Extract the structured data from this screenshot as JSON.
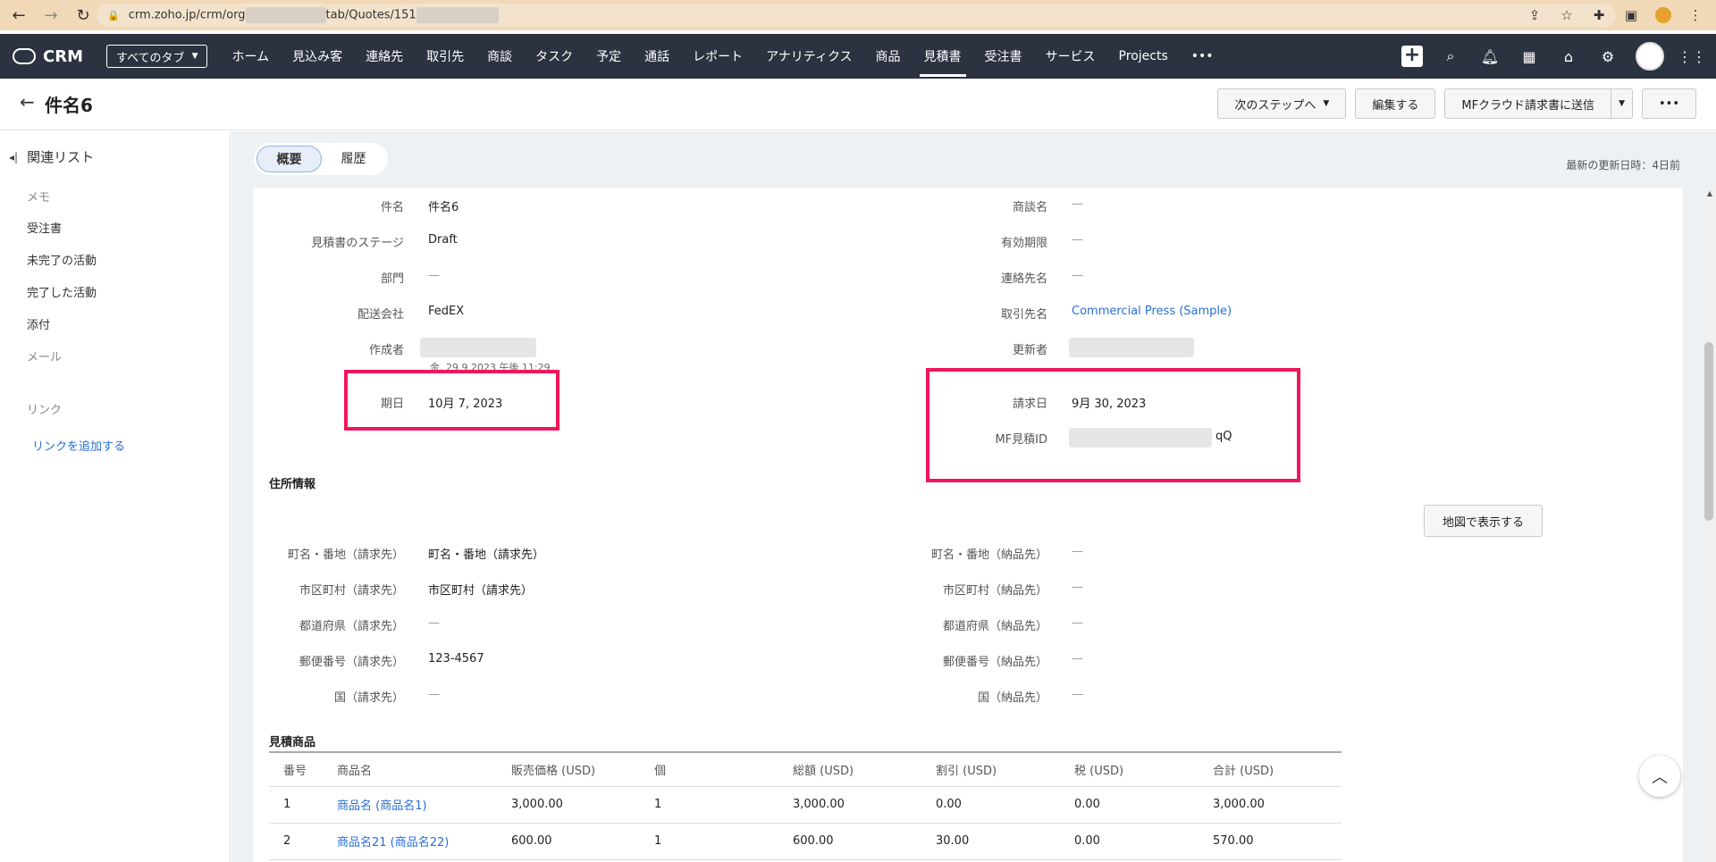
{
  "browser": {
    "url_prefix": "crm.zoho.jp/crm/org",
    "url_mid": "tab/Quotes/151"
  },
  "header": {
    "logo": "CRM",
    "tab_select": "すべてのタブ",
    "nav": [
      "ホーム",
      "見込み客",
      "連絡先",
      "取引先",
      "商談",
      "タスク",
      "予定",
      "通話",
      "レポート",
      "アナリティクス",
      "商品",
      "見積書",
      "受注書",
      "サービス",
      "Projects"
    ],
    "active_nav": "見積書",
    "more": "•••"
  },
  "title_bar": {
    "title": "件名6",
    "next_step": "次のステップへ",
    "edit": "編集する",
    "send_mf": "MFクラウド請求書に送信",
    "more": "•••"
  },
  "sidebar": {
    "heading": "関連リスト",
    "items": [
      "メモ",
      "受注書",
      "未完了の活動",
      "完了した活動",
      "添付",
      "メール"
    ],
    "link_heading": "リンク",
    "add_link": "リンクを追加する"
  },
  "tabs": {
    "overview": "概要",
    "history": "履歴",
    "last_modified": "最新の更新日時：4日前"
  },
  "details": {
    "subject_label": "件名",
    "subject": "件名6",
    "stage_label": "見積書のステージ",
    "stage": "Draft",
    "team_label": "部門",
    "team": "—",
    "carrier_label": "配送会社",
    "carrier": "FedEX",
    "created_label": "作成者",
    "created_time": "金, 29.9.2023 午後 11:29",
    "due_label": "期日",
    "due": "10月 7, 2023",
    "deal_label": "商談名",
    "deal": "—",
    "valid_label": "有効期限",
    "valid": "—",
    "contact_label": "連絡先名",
    "contact": "—",
    "account_label": "取引先名",
    "account": "Commercial Press (Sample)",
    "modified_label": "更新者",
    "invoice_date_label": "請求日",
    "invoice_date": "9月 30, 2023",
    "mf_id_label": "MF見積ID",
    "mf_id_suffix": "qQ"
  },
  "address": {
    "title": "住所情報",
    "map_button": "地図で表示する",
    "bill_street_label": "町名・番地（請求先）",
    "bill_street": "町名・番地（請求先）",
    "bill_city_label": "市区町村（請求先）",
    "bill_city": "市区町村（請求先）",
    "bill_state_label": "都道府県（請求先）",
    "bill_state": "—",
    "bill_zip_label": "郵便番号（請求先）",
    "bill_zip": "123-4567",
    "bill_country_label": "国（請求先）",
    "bill_country": "—",
    "ship_street_label": "町名・番地（納品先）",
    "ship_street": "—",
    "ship_city_label": "市区町村（納品先）",
    "ship_city": "—",
    "ship_state_label": "都道府県（納品先）",
    "ship_state": "—",
    "ship_zip_label": "郵便番号（納品先）",
    "ship_zip": "—",
    "ship_country_label": "国（納品先）",
    "ship_country": "—"
  },
  "products": {
    "title": "見積商品",
    "headers": [
      "番号",
      "商品名",
      "販売価格 (USD)",
      "個",
      "総額 (USD)",
      "割引 (USD)",
      "税 (USD)",
      "合計 (USD)"
    ],
    "rows": [
      [
        "1",
        "商品名 (商品名1)",
        "3,000.00",
        "1",
        "3,000.00",
        "0.00",
        "0.00",
        "3,000.00"
      ],
      [
        "2",
        "商品名21 (商品名22)",
        "600.00",
        "1",
        "600.00",
        "30.00",
        "0.00",
        "570.00"
      ]
    ]
  },
  "colors": {
    "header_bg": "#2b3340",
    "highlight": "#f0165c",
    "link": "#2a6ed4"
  }
}
